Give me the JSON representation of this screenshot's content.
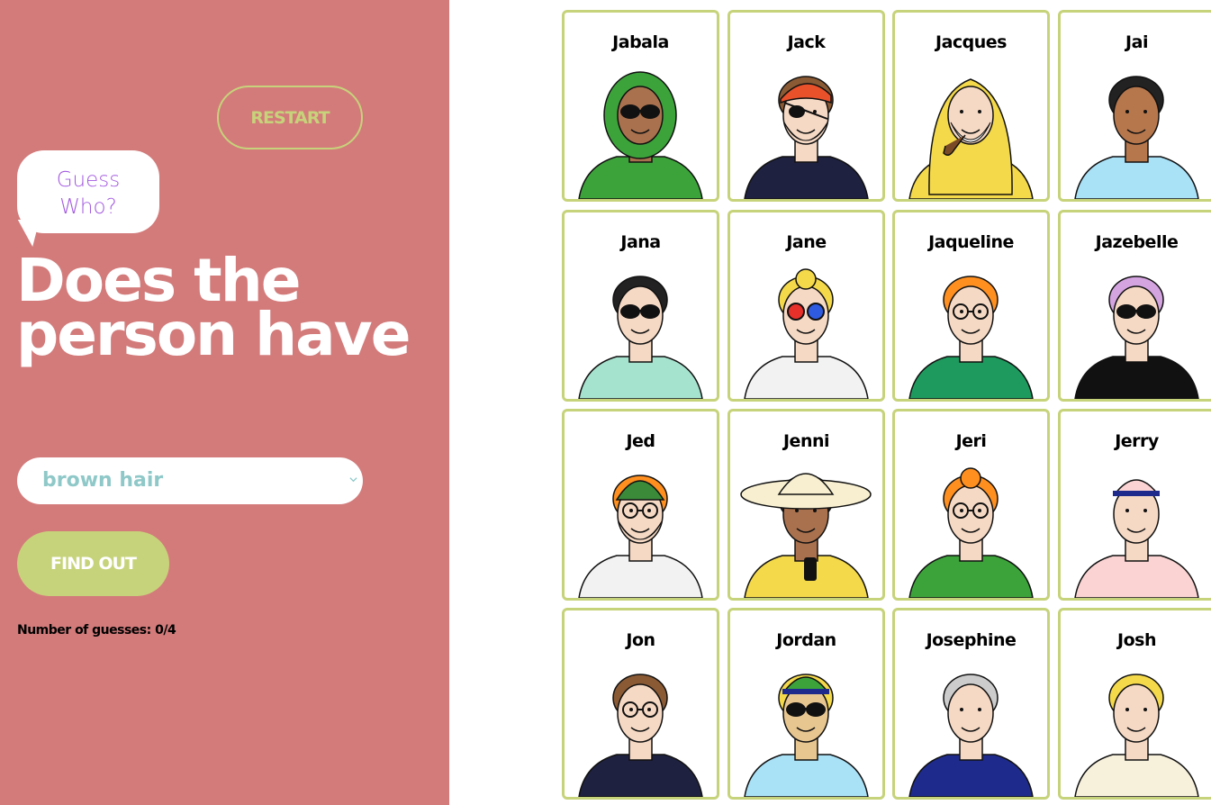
{
  "controls": {
    "restart_label": "RESTART",
    "find_out_label": "FIND OUT",
    "selected_option": "brown hair"
  },
  "logo": {
    "line1": "Guess",
    "line2": "Who?"
  },
  "question": "Does the person have",
  "status": {
    "guesses": "Number of guesses: 0/4"
  },
  "characters": [
    {
      "name": "Jabala",
      "skin": "#a9714e",
      "hair": "#3ca33a",
      "top": "#3ca33a",
      "acc": "sunglasses",
      "hat": "hijab"
    },
    {
      "name": "Jack",
      "skin": "#f6d9c4",
      "hair": "#8a5a34",
      "top": "#1e2140",
      "acc": "eyepatch",
      "hat": "bandana"
    },
    {
      "name": "Jacques",
      "skin": "#f6d9c4",
      "hair": "#dddddd",
      "top": "#f4d94a",
      "acc": "pipe",
      "hat": "raincoat"
    },
    {
      "name": "Jai",
      "skin": "#b7774d",
      "hair": "#222222",
      "top": "#a9e1f7",
      "acc": "none",
      "hat": "none"
    },
    {
      "name": "Jana",
      "skin": "#f6d9c4",
      "hair": "#222222",
      "top": "#a6e3cf",
      "acc": "sunglasses",
      "hat": "none"
    },
    {
      "name": "Jane",
      "skin": "#f6d9c4",
      "hair": "#f4d94a",
      "top": "#f2f2f2",
      "acc": "colorglasses",
      "hat": "bun"
    },
    {
      "name": "Jaqueline",
      "skin": "#f6d9c4",
      "hair": "#ff8f1f",
      "top": "#1e9a5e",
      "acc": "glasses",
      "hat": "none"
    },
    {
      "name": "Jazebelle",
      "skin": "#f6d9c4",
      "hair": "#d4a4e0",
      "top": "#111111",
      "acc": "sunglasses",
      "hat": "none"
    },
    {
      "name": "Jed",
      "skin": "#f6d9c4",
      "hair": "#ff8f1f",
      "top": "#f2f2f2",
      "acc": "glasses",
      "hat": "beanie"
    },
    {
      "name": "Jenni",
      "skin": "#a9714e",
      "hair": "#333333",
      "top": "#f4d94a",
      "acc": "phone",
      "hat": "sunhat"
    },
    {
      "name": "Jeri",
      "skin": "#f6d9c4",
      "hair": "#ff8f1f",
      "top": "#3ca33a",
      "acc": "glasses",
      "hat": "bun"
    },
    {
      "name": "Jerry",
      "skin": "#f6d9c4",
      "hair": "#f6d9c4",
      "top": "#fbd3d3",
      "acc": "none",
      "hat": "cap"
    },
    {
      "name": "Jon",
      "skin": "#f6d9c4",
      "hair": "#8a5a34",
      "top": "#1e2140",
      "acc": "glasses",
      "hat": "none"
    },
    {
      "name": "Jordan",
      "skin": "#e7c690",
      "hair": "#f4d94a",
      "top": "#a9e1f7",
      "acc": "sunglasses",
      "hat": "greencap"
    },
    {
      "name": "Josephine",
      "skin": "#f6d9c4",
      "hair": "#cccccc",
      "top": "#1e2b8c",
      "acc": "none",
      "hat": "none"
    },
    {
      "name": "Josh",
      "skin": "#f6d9c4",
      "hair": "#f4d94a",
      "top": "#f7f1dc",
      "acc": "none",
      "hat": "none"
    }
  ]
}
